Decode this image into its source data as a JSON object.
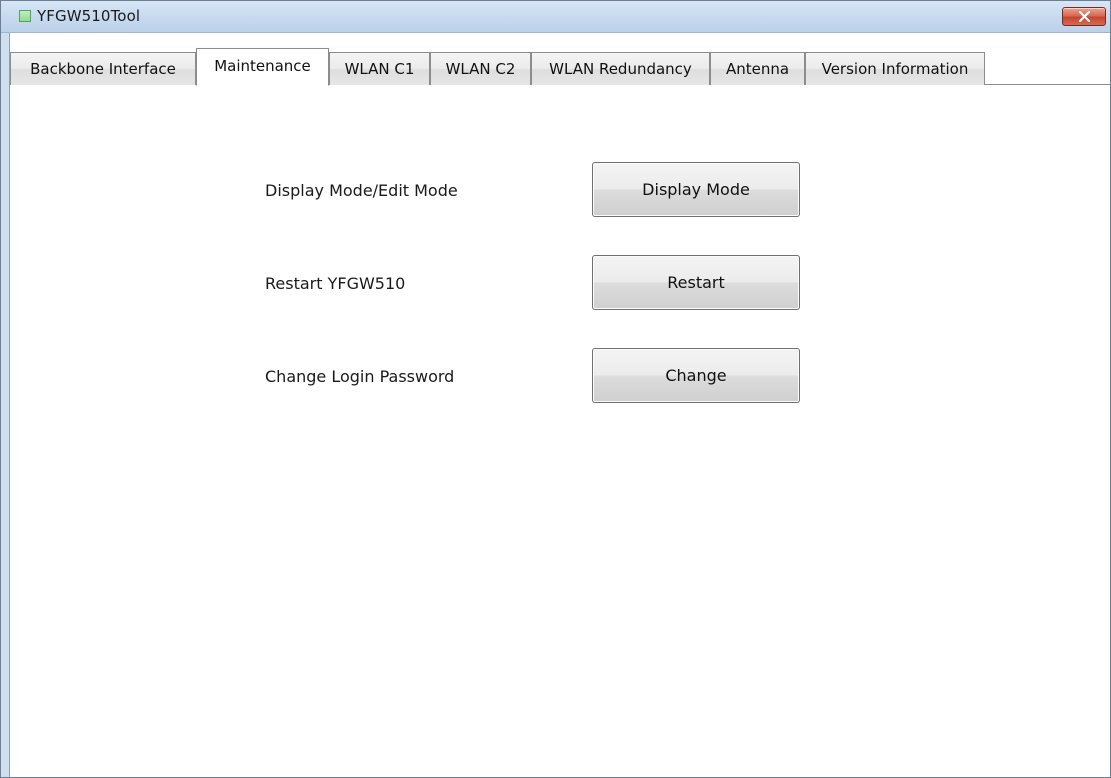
{
  "window": {
    "title": "YFGW510Tool",
    "close_label": "Close"
  },
  "tabs": [
    {
      "label": "Backbone Interface",
      "active": false
    },
    {
      "label": "Maintenance",
      "active": true
    },
    {
      "label": "WLAN C1",
      "active": false
    },
    {
      "label": "WLAN C2",
      "active": false
    },
    {
      "label": "WLAN Redundancy",
      "active": false
    },
    {
      "label": "Antenna",
      "active": false
    },
    {
      "label": "Version Information",
      "active": false
    }
  ],
  "maintenance": {
    "rows": [
      {
        "label": "Display Mode/Edit Mode",
        "button": "Display Mode"
      },
      {
        "label": "Restart YFGW510",
        "button": "Restart"
      },
      {
        "label": "Change Login Password",
        "button": "Change"
      }
    ]
  },
  "colors": {
    "titlebar": "#c6d9ee",
    "close_button": "#d86a52",
    "app_icon": "#8fdc92"
  },
  "icons": {
    "app": "app-status-square-icon",
    "close": "close-x-icon"
  }
}
